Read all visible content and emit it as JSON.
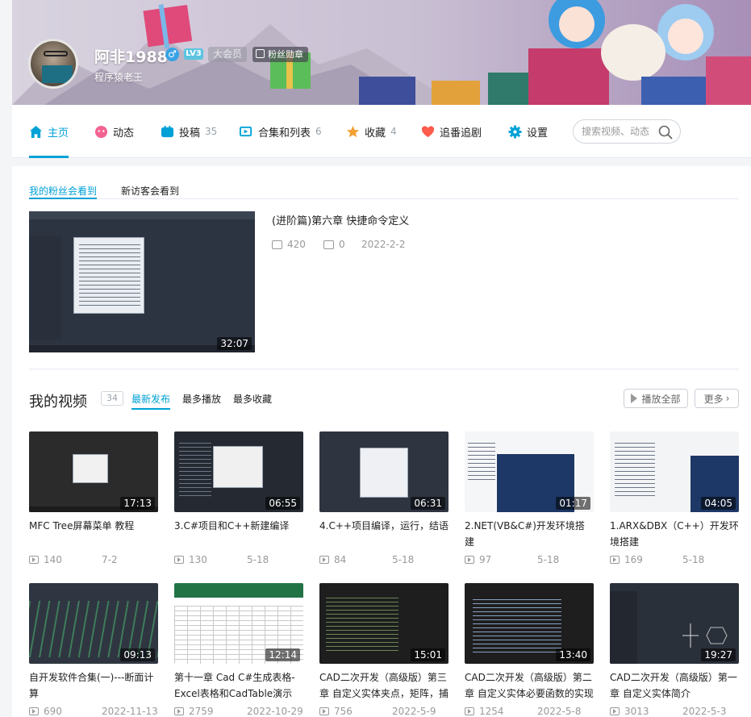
{
  "profile": {
    "name": "阿非1988",
    "gender_symbol": "♂",
    "level": "LV3",
    "vip": "大会员",
    "fan_medal": "粉丝勋章",
    "sign": "程序猿老王"
  },
  "nav": {
    "items": [
      {
        "label": "主页",
        "count": "",
        "icon": "home-icon",
        "color": "#00a1d6"
      },
      {
        "label": "动态",
        "count": "",
        "icon": "dynamic-icon",
        "color": "#f36392"
      },
      {
        "label": "投稿",
        "count": "35",
        "icon": "upload-icon",
        "color": "#00a1d6"
      },
      {
        "label": "合集和列表",
        "count": "6",
        "icon": "collection-icon",
        "color": "#00a1d6"
      },
      {
        "label": "收藏",
        "count": "4",
        "icon": "favorite-icon",
        "color": "#f3a034"
      },
      {
        "label": "追番追剧",
        "count": "",
        "icon": "follow-bangumi-icon",
        "color": "#ff5c7c"
      },
      {
        "label": "设置",
        "count": "",
        "icon": "settings-icon",
        "color": "#00a1d6"
      }
    ],
    "search_placeholder": "搜索视频、动态"
  },
  "top_tabs": [
    "我的粉丝会看到",
    "新访客会看到"
  ],
  "featured": {
    "title": "(进阶篇)第六章 快捷命令定义",
    "duration": "32:07",
    "plays": "420",
    "comments": "0",
    "date": "2022-2-2"
  },
  "videos_section": {
    "title": "我的视频",
    "count": "34",
    "tabs": [
      "最新发布",
      "最多播放",
      "最多收藏"
    ],
    "play_all": "播放全部",
    "more": "更多",
    "videos": [
      {
        "title": "MFC Tree屏幕菜单 教程",
        "duration": "17:13",
        "plays": "140",
        "date": "7-2"
      },
      {
        "title": "3.C#项目和C++新建编译",
        "duration": "06:55",
        "plays": "130",
        "date": "5-18"
      },
      {
        "title": "4.C++项目编译，运行，结语",
        "duration": "06:31",
        "plays": "84",
        "date": "5-18"
      },
      {
        "title": "2.NET(VB&C#)开发环境搭建",
        "duration": "01:17",
        "plays": "97",
        "date": "5-18"
      },
      {
        "title": "1.ARX&DBX（C++）开发环境搭建",
        "duration": "04:05",
        "plays": "169",
        "date": "5-18"
      },
      {
        "title": "自开发软件合集(一)---断面计算",
        "duration": "09:13",
        "plays": "690",
        "date": "2022-11-13"
      },
      {
        "title": "第十一章 Cad C#生成表格-Excel表格和CadTable演示",
        "duration": "12:14",
        "plays": "2759",
        "date": "2022-10-29"
      },
      {
        "title": "CAD二次开发（高级版）第三章 自定义实体夹点，矩阵，捕",
        "duration": "15:01",
        "plays": "756",
        "date": "2022-5-9"
      },
      {
        "title": "CAD二次开发（高级版）第二章 自定义实体必要函数的实现",
        "duration": "13:40",
        "plays": "1254",
        "date": "2022-5-8"
      },
      {
        "title": "CAD二次开发（高级版）第一章 自定义实体简介",
        "duration": "19:27",
        "plays": "3013",
        "date": "2022-5-3"
      }
    ]
  }
}
